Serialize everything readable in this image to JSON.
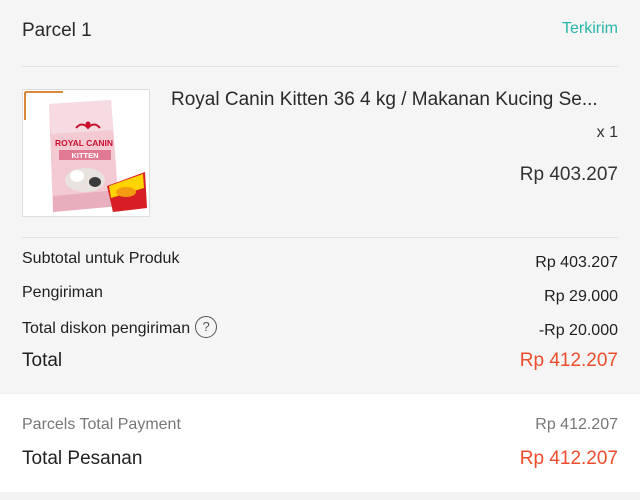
{
  "colors": {
    "accent_teal": "#27b5a8",
    "accent_orange": "#ee4d2d",
    "text": "#222222",
    "muted": "#777777"
  },
  "parcel": {
    "title": "Parcel 1",
    "status": "Terkirim"
  },
  "product": {
    "image_icon": "product-thumbnail",
    "brand_text": "ROYAL CANIN",
    "variant_text": "KITTEN",
    "name": "Royal Canin Kitten 36 4 kg / Makanan Kucing Se...",
    "qty": "x 1",
    "price": "Rp 403.207"
  },
  "summary": {
    "subtotal_label": "Subtotal untuk Produk",
    "subtotal_value": "Rp 403.207",
    "shipping_label": "Pengiriman",
    "shipping_value": "Rp 29.000",
    "discount_label": "Total diskon pengiriman",
    "discount_help_icon": "?",
    "discount_value": "-Rp 20.000",
    "total_label": "Total",
    "total_value": "Rp 412.207"
  },
  "payment": {
    "parcels_label": "Parcels Total Payment",
    "parcels_value": "Rp 412.207",
    "order_total_label": "Total Pesanan",
    "order_total_value": "Rp 412.207"
  }
}
